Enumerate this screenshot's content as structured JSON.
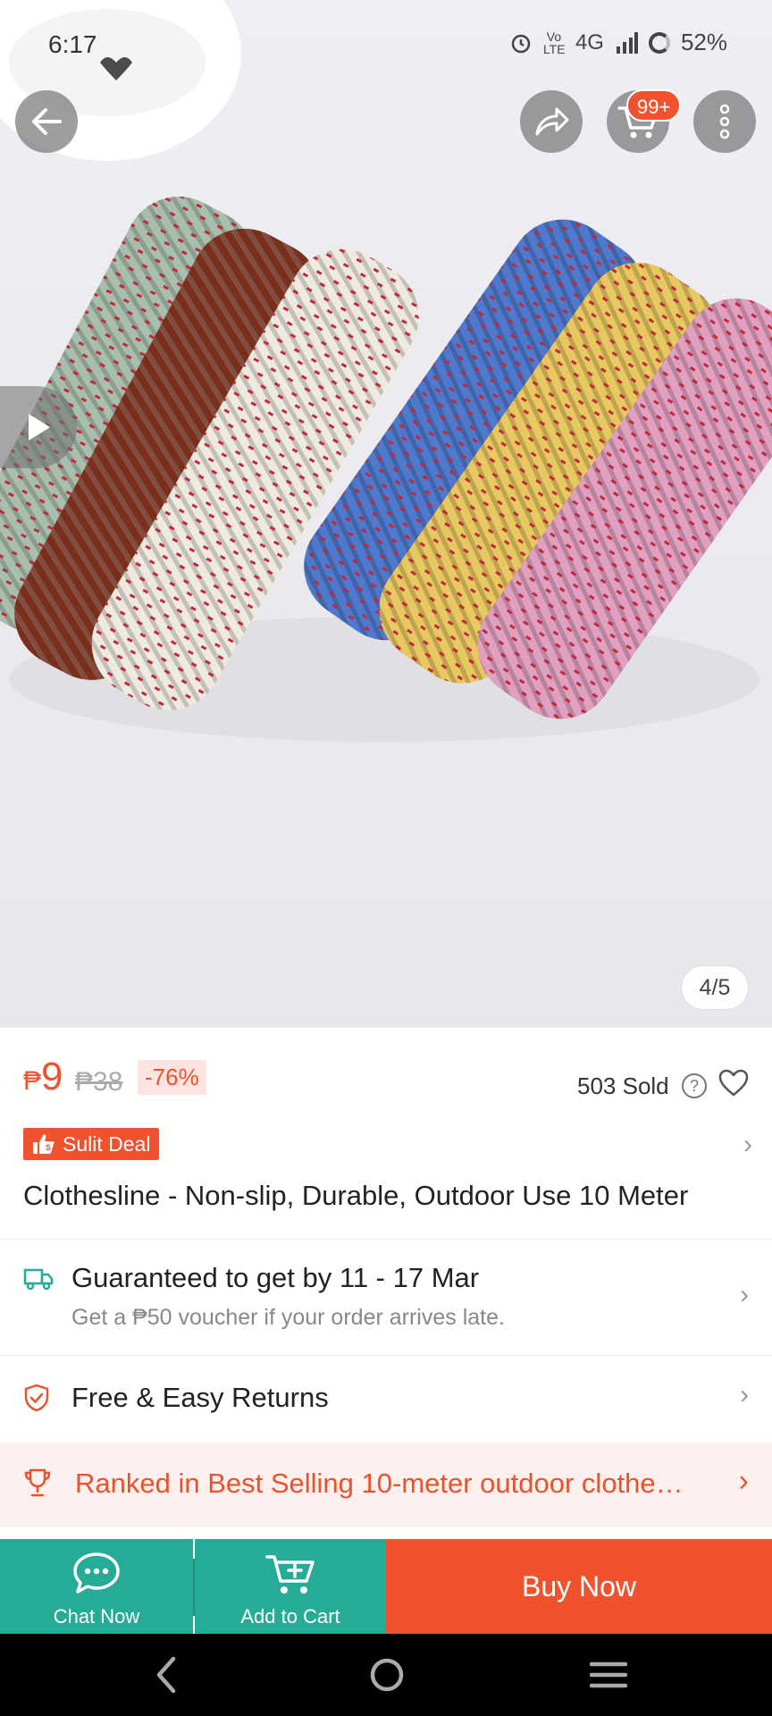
{
  "status_bar": {
    "time": "6:17",
    "network_label": "4G",
    "lte_label": "Vo LTE",
    "battery": "52%"
  },
  "header": {
    "cart_badge": "99+"
  },
  "gallery": {
    "counter": "4/5"
  },
  "price": {
    "currency": "₱",
    "current": "9",
    "original": "₱38",
    "discount": "-76%",
    "sold": "503 Sold",
    "help_symbol": "?"
  },
  "deal": {
    "label": "Sulit Deal"
  },
  "product": {
    "title": "Clothesline - Non-slip, Durable, Outdoor Use 10 Meter"
  },
  "delivery": {
    "title": "Guaranteed to get by 11 - 17 Mar",
    "subtitle": "Get a ₱50 voucher if your order arrives late."
  },
  "returns": {
    "label": "Free & Easy Returns"
  },
  "ranked": {
    "label": "Ranked in Best Selling 10-meter outdoor clothe…"
  },
  "actions": {
    "chat_label": "Chat Now",
    "add_cart_label": "Add to Cart",
    "buy_now_label": "Buy Now"
  },
  "colors": {
    "brand_orange": "#f0522d",
    "teal": "#26ab96"
  }
}
